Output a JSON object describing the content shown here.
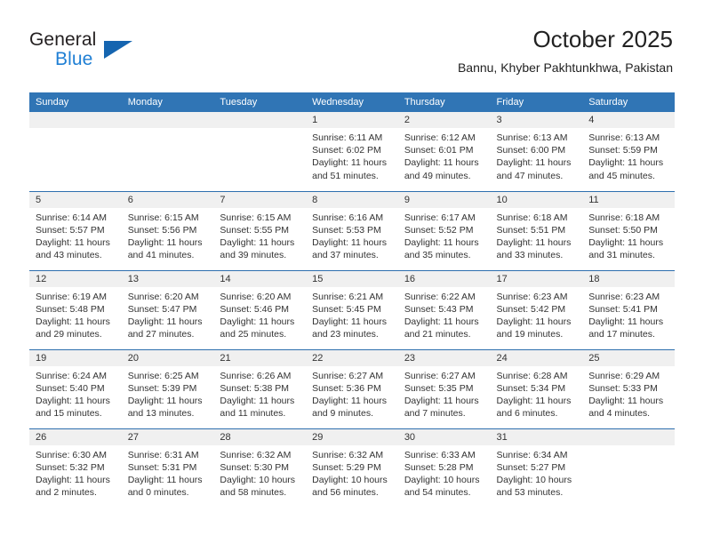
{
  "brand": {
    "word_one": "General",
    "word_two": "Blue",
    "icon": "triangle-logo"
  },
  "header": {
    "title": "October 2025",
    "location": "Bannu, Khyber Pakhtunkhwa, Pakistan"
  },
  "colors": {
    "header_blue": "#3075b5",
    "row_divider_blue": "#2e6fae",
    "daynum_band": "#f0f0f0",
    "brand_blue": "#1f7fd4",
    "logo_blue": "#1565b0",
    "text": "#333333"
  },
  "calendar": {
    "weekday_headers": [
      "Sunday",
      "Monday",
      "Tuesday",
      "Wednesday",
      "Thursday",
      "Friday",
      "Saturday"
    ],
    "labels": {
      "sunrise": "Sunrise:",
      "sunset": "Sunset:",
      "daylight": "Daylight:"
    },
    "weeks": [
      [
        {
          "day": "",
          "empty": true
        },
        {
          "day": "",
          "empty": true
        },
        {
          "day": "",
          "empty": true
        },
        {
          "day": "1",
          "sunrise": "Sunrise: 6:11 AM",
          "sunset": "Sunset: 6:02 PM",
          "daylight": "Daylight: 11 hours and 51 minutes."
        },
        {
          "day": "2",
          "sunrise": "Sunrise: 6:12 AM",
          "sunset": "Sunset: 6:01 PM",
          "daylight": "Daylight: 11 hours and 49 minutes."
        },
        {
          "day": "3",
          "sunrise": "Sunrise: 6:13 AM",
          "sunset": "Sunset: 6:00 PM",
          "daylight": "Daylight: 11 hours and 47 minutes."
        },
        {
          "day": "4",
          "sunrise": "Sunrise: 6:13 AM",
          "sunset": "Sunset: 5:59 PM",
          "daylight": "Daylight: 11 hours and 45 minutes."
        }
      ],
      [
        {
          "day": "5",
          "sunrise": "Sunrise: 6:14 AM",
          "sunset": "Sunset: 5:57 PM",
          "daylight": "Daylight: 11 hours and 43 minutes."
        },
        {
          "day": "6",
          "sunrise": "Sunrise: 6:15 AM",
          "sunset": "Sunset: 5:56 PM",
          "daylight": "Daylight: 11 hours and 41 minutes."
        },
        {
          "day": "7",
          "sunrise": "Sunrise: 6:15 AM",
          "sunset": "Sunset: 5:55 PM",
          "daylight": "Daylight: 11 hours and 39 minutes."
        },
        {
          "day": "8",
          "sunrise": "Sunrise: 6:16 AM",
          "sunset": "Sunset: 5:53 PM",
          "daylight": "Daylight: 11 hours and 37 minutes."
        },
        {
          "day": "9",
          "sunrise": "Sunrise: 6:17 AM",
          "sunset": "Sunset: 5:52 PM",
          "daylight": "Daylight: 11 hours and 35 minutes."
        },
        {
          "day": "10",
          "sunrise": "Sunrise: 6:18 AM",
          "sunset": "Sunset: 5:51 PM",
          "daylight": "Daylight: 11 hours and 33 minutes."
        },
        {
          "day": "11",
          "sunrise": "Sunrise: 6:18 AM",
          "sunset": "Sunset: 5:50 PM",
          "daylight": "Daylight: 11 hours and 31 minutes."
        }
      ],
      [
        {
          "day": "12",
          "sunrise": "Sunrise: 6:19 AM",
          "sunset": "Sunset: 5:48 PM",
          "daylight": "Daylight: 11 hours and 29 minutes."
        },
        {
          "day": "13",
          "sunrise": "Sunrise: 6:20 AM",
          "sunset": "Sunset: 5:47 PM",
          "daylight": "Daylight: 11 hours and 27 minutes."
        },
        {
          "day": "14",
          "sunrise": "Sunrise: 6:20 AM",
          "sunset": "Sunset: 5:46 PM",
          "daylight": "Daylight: 11 hours and 25 minutes."
        },
        {
          "day": "15",
          "sunrise": "Sunrise: 6:21 AM",
          "sunset": "Sunset: 5:45 PM",
          "daylight": "Daylight: 11 hours and 23 minutes."
        },
        {
          "day": "16",
          "sunrise": "Sunrise: 6:22 AM",
          "sunset": "Sunset: 5:43 PM",
          "daylight": "Daylight: 11 hours and 21 minutes."
        },
        {
          "day": "17",
          "sunrise": "Sunrise: 6:23 AM",
          "sunset": "Sunset: 5:42 PM",
          "daylight": "Daylight: 11 hours and 19 minutes."
        },
        {
          "day": "18",
          "sunrise": "Sunrise: 6:23 AM",
          "sunset": "Sunset: 5:41 PM",
          "daylight": "Daylight: 11 hours and 17 minutes."
        }
      ],
      [
        {
          "day": "19",
          "sunrise": "Sunrise: 6:24 AM",
          "sunset": "Sunset: 5:40 PM",
          "daylight": "Daylight: 11 hours and 15 minutes."
        },
        {
          "day": "20",
          "sunrise": "Sunrise: 6:25 AM",
          "sunset": "Sunset: 5:39 PM",
          "daylight": "Daylight: 11 hours and 13 minutes."
        },
        {
          "day": "21",
          "sunrise": "Sunrise: 6:26 AM",
          "sunset": "Sunset: 5:38 PM",
          "daylight": "Daylight: 11 hours and 11 minutes."
        },
        {
          "day": "22",
          "sunrise": "Sunrise: 6:27 AM",
          "sunset": "Sunset: 5:36 PM",
          "daylight": "Daylight: 11 hours and 9 minutes."
        },
        {
          "day": "23",
          "sunrise": "Sunrise: 6:27 AM",
          "sunset": "Sunset: 5:35 PM",
          "daylight": "Daylight: 11 hours and 7 minutes."
        },
        {
          "day": "24",
          "sunrise": "Sunrise: 6:28 AM",
          "sunset": "Sunset: 5:34 PM",
          "daylight": "Daylight: 11 hours and 6 minutes."
        },
        {
          "day": "25",
          "sunrise": "Sunrise: 6:29 AM",
          "sunset": "Sunset: 5:33 PM",
          "daylight": "Daylight: 11 hours and 4 minutes."
        }
      ],
      [
        {
          "day": "26",
          "sunrise": "Sunrise: 6:30 AM",
          "sunset": "Sunset: 5:32 PM",
          "daylight": "Daylight: 11 hours and 2 minutes."
        },
        {
          "day": "27",
          "sunrise": "Sunrise: 6:31 AM",
          "sunset": "Sunset: 5:31 PM",
          "daylight": "Daylight: 11 hours and 0 minutes."
        },
        {
          "day": "28",
          "sunrise": "Sunrise: 6:32 AM",
          "sunset": "Sunset: 5:30 PM",
          "daylight": "Daylight: 10 hours and 58 minutes."
        },
        {
          "day": "29",
          "sunrise": "Sunrise: 6:32 AM",
          "sunset": "Sunset: 5:29 PM",
          "daylight": "Daylight: 10 hours and 56 minutes."
        },
        {
          "day": "30",
          "sunrise": "Sunrise: 6:33 AM",
          "sunset": "Sunset: 5:28 PM",
          "daylight": "Daylight: 10 hours and 54 minutes."
        },
        {
          "day": "31",
          "sunrise": "Sunrise: 6:34 AM",
          "sunset": "Sunset: 5:27 PM",
          "daylight": "Daylight: 10 hours and 53 minutes."
        },
        {
          "day": "",
          "empty": true
        }
      ]
    ]
  }
}
